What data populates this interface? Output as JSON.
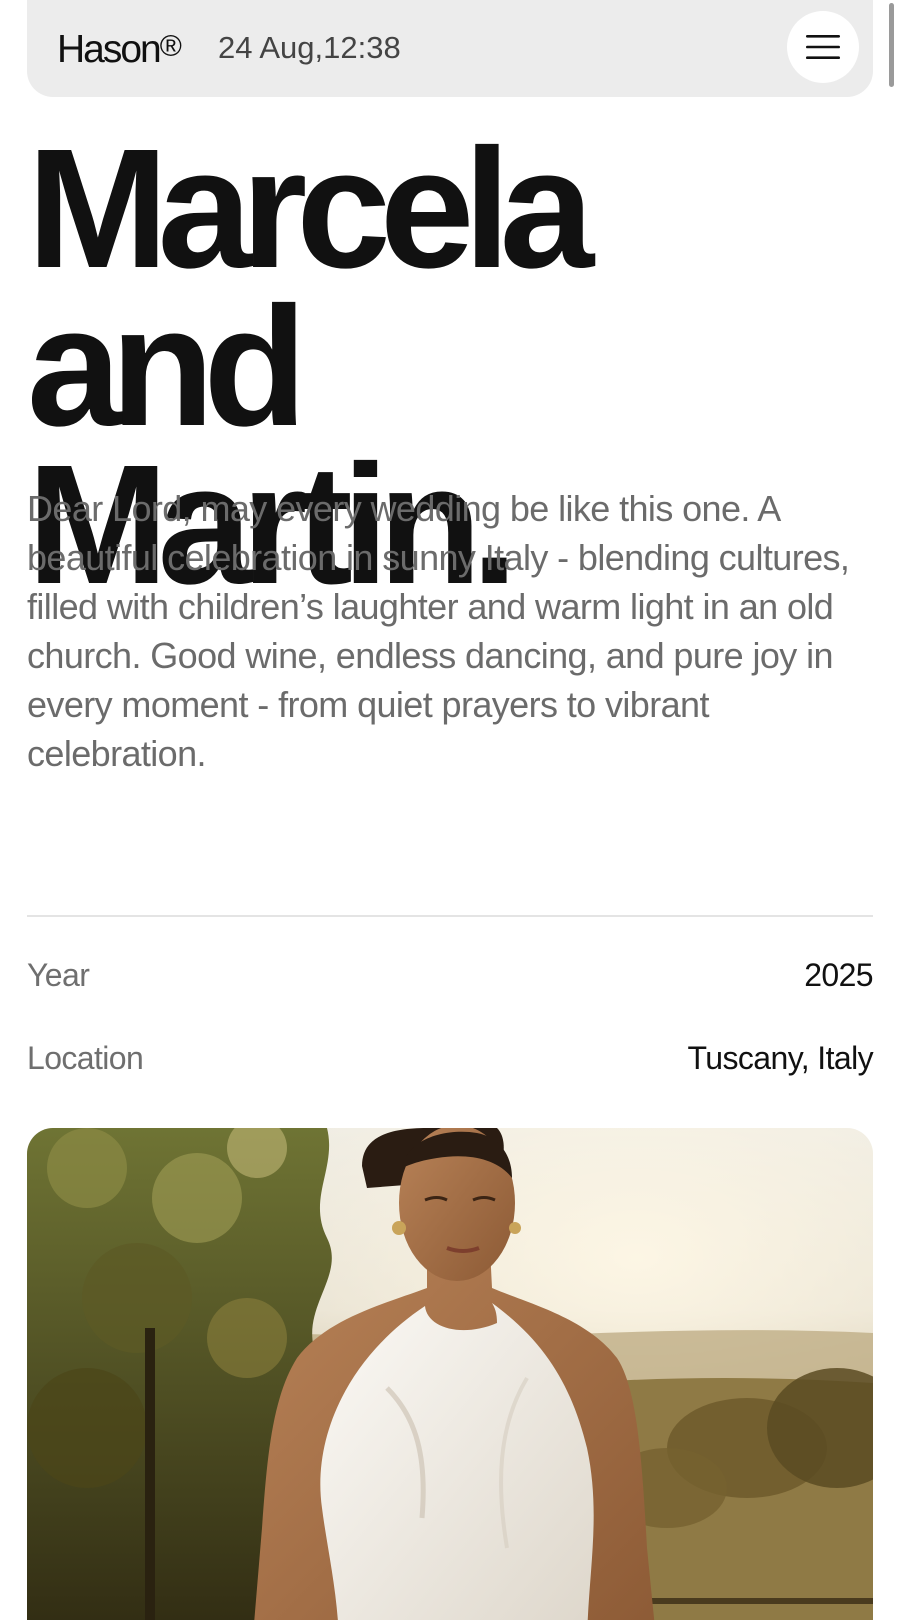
{
  "header": {
    "brand": "Hason",
    "brand_mark": "®",
    "datetime": "24 Aug,12:38",
    "menu_icon": "hamburger-menu-icon"
  },
  "hero": {
    "title_line1": "Marcela and",
    "title_line2": "Martin.",
    "description": "Dear Lord, may every wedding be like this one. A beautiful celebration in sunny Italy - blending cultures, filled with children’s laughter and warm light in an old church. Good wine, endless dancing, and pure joy in every moment - from quiet prayers to vibrant celebration."
  },
  "details": [
    {
      "label": "Year",
      "value": "2025"
    },
    {
      "label": "Location",
      "value": "Tuscany, Italy"
    }
  ],
  "colors": {
    "background": "#ffffff",
    "header_bg": "#ececec",
    "title": "#111111",
    "body_text": "#6b6b6b"
  }
}
